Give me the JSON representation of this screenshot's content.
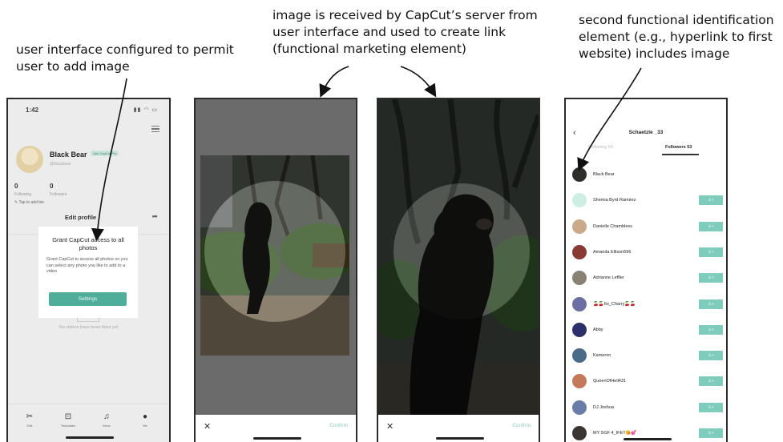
{
  "annotations": {
    "left": "user interface configured to permit user to add image",
    "middle": "image is received by CapCut’s server from user interface and used to create link (functional marketing element)",
    "right": "second functional identification element (e.g., hyperlink to first website) includes image"
  },
  "phone1": {
    "status_time": "1:42",
    "profile_name": "Black Bear",
    "pro_badge": "Join CapCut Pro",
    "handle": "@blackbear",
    "following_count": "0",
    "following_label": "Following",
    "followers_count": "0",
    "followers_label": "Followers",
    "bio_prompt": "Tap to add bio",
    "edit_profile_label": "Edit profile",
    "dialog": {
      "title": "Grant CapCut access to all photos",
      "body": "Grant CapCut to access all photos so you can select any photo you like to add to a video",
      "button": "Settings"
    },
    "empty_state": "No videos have been liked yet",
    "nav": [
      "Edit",
      "Templates",
      "Inbox",
      "Me"
    ]
  },
  "phone2": {
    "close_label": "✕",
    "confirm_label": "Confirm"
  },
  "phone3": {
    "close_label": "✕",
    "confirm_label": "Confirm"
  },
  "phone4": {
    "title": "Schaetzle _33",
    "following_tab": "Following 60",
    "followers_tab": "Followers 53",
    "rows": [
      {
        "name": "Black Bear",
        "avatar_color": "#2e2e2a",
        "button": ""
      },
      {
        "name": "Shemia Byrd Ramirez",
        "avatar_color": "#cdeee3",
        "button": "♙+"
      },
      {
        "name": "Danielle Chambless",
        "avatar_color": "#c9a98a",
        "button": "♙+"
      },
      {
        "name": "Amanda Ellison596",
        "avatar_color": "#8a3a34",
        "button": "♙+"
      },
      {
        "name": "Adrianne Leffler",
        "avatar_color": "#8a8175",
        "button": "♙+"
      },
      {
        "name": "🍒🍒Ito_Charry🍒🍒",
        "avatar_color": "#6b6fa3",
        "button": "♙+"
      },
      {
        "name": "Abby",
        "avatar_color": "#2b2f6a",
        "button": "♙+"
      },
      {
        "name": "Kameron",
        "avatar_color": "#4a6a8a",
        "button": "♙+"
      },
      {
        "name": "QueenOfHell431",
        "avatar_color": "#c47a5a",
        "button": "♙+"
      },
      {
        "name": "DJ Joshua",
        "avatar_color": "#6a7ca8",
        "button": "♙+"
      },
      {
        "name": "MY SGF 4_IFE!!😘💕",
        "avatar_color": "#3a3530",
        "button": "♙+"
      }
    ]
  }
}
